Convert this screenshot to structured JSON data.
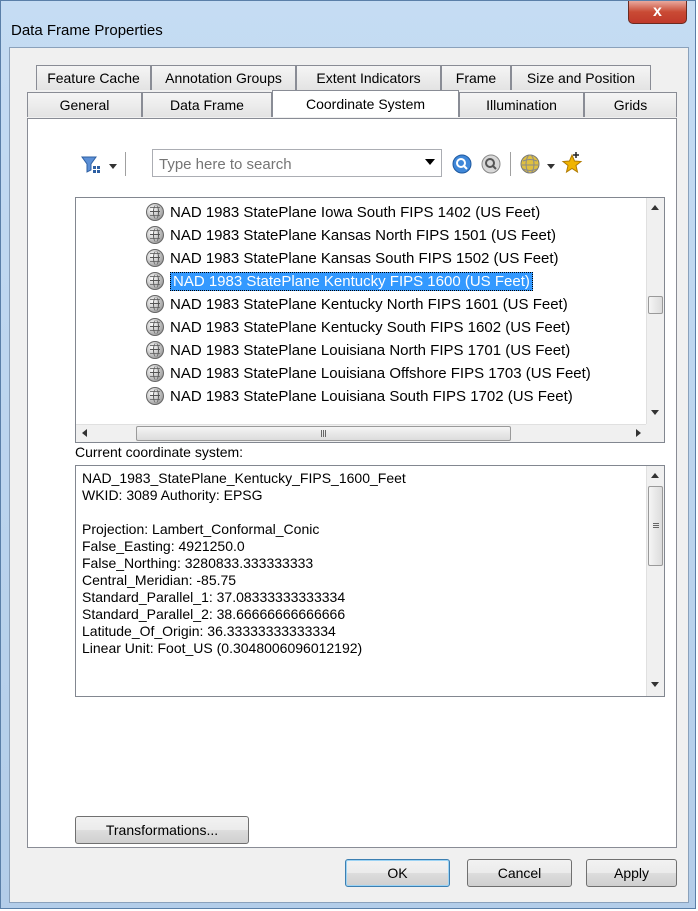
{
  "window": {
    "title": "Data Frame Properties",
    "close_glyph": "x"
  },
  "tabs_row1": [
    "Feature Cache",
    "Annotation Groups",
    "Extent Indicators",
    "Frame",
    "Size and Position"
  ],
  "tabs_row2": [
    "General",
    "Data Frame",
    "Coordinate System",
    "Illumination",
    "Grids"
  ],
  "active_tab": "Coordinate System",
  "toolbar": {
    "search_placeholder": "Type here to search",
    "icons": [
      "filter-icon",
      "search-icon",
      "search-options-icon",
      "globe-icon",
      "add-favorite-icon"
    ]
  },
  "crs_list": {
    "items": [
      "NAD 1983 StatePlane Iowa South FIPS 1402 (US Feet)",
      "NAD 1983 StatePlane Kansas North FIPS 1501 (US Feet)",
      "NAD 1983 StatePlane Kansas South FIPS 1502 (US Feet)",
      "NAD 1983 StatePlane Kentucky FIPS 1600 (US Feet)",
      "NAD 1983 StatePlane Kentucky North FIPS 1601 (US Feet)",
      "NAD 1983 StatePlane Kentucky South FIPS 1602 (US Feet)",
      "NAD 1983 StatePlane Louisiana North FIPS 1701 (US Feet)",
      "NAD 1983 StatePlane Louisiana Offshore FIPS 1703 (US Feet)",
      "NAD 1983 StatePlane Louisiana South FIPS 1702 (US Feet)"
    ],
    "selected": "NAD 1983 StatePlane Kentucky FIPS 1600 (US Feet)"
  },
  "current": {
    "label": "Current coordinate system:",
    "lines": [
      "NAD_1983_StatePlane_Kentucky_FIPS_1600_Feet",
      "WKID: 3089 Authority: EPSG",
      "",
      "Projection: Lambert_Conformal_Conic",
      "False_Easting: 4921250.0",
      "False_Northing: 3280833.333333333",
      "Central_Meridian: -85.75",
      "Standard_Parallel_1: 37.08333333333334",
      "Standard_Parallel_2: 38.66666666666666",
      "Latitude_Of_Origin: 36.33333333333334",
      "Linear Unit: Foot_US (0.3048006096012192)"
    ]
  },
  "buttons": {
    "transformations": "Transformations...",
    "ok": "OK",
    "cancel": "Cancel",
    "apply": "Apply"
  },
  "colors": {
    "selection": "#3399ff",
    "title_bar": "#c5dcf3",
    "close_button": "#c94a34"
  }
}
